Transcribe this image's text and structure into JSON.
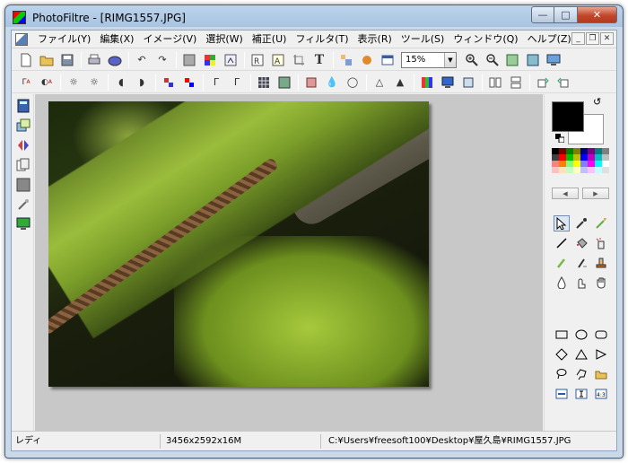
{
  "window": {
    "title": "PhotoFiltre - [RIMG1557.JPG]"
  },
  "menu": {
    "items": [
      "ファイル(Y)",
      "編集(X)",
      "イメージ(V)",
      "選択(W)",
      "補正(U)",
      "フィルタ(T)",
      "表示(R)",
      "ツール(S)",
      "ウィンドウ(Q)",
      "ヘルプ(Z)"
    ]
  },
  "toolbar": {
    "zoom_value": "15%"
  },
  "status": {
    "state": "レディ",
    "dimensions": "3456x2592x16M",
    "path": "C:¥Users¥freesoft100¥Desktop¥屋久島¥RIMG1557.JPG"
  },
  "colors": {
    "foreground": "#000000",
    "background": "#ffffff",
    "accent": "#4a5f7a",
    "palette": [
      "#000000",
      "#7f0000",
      "#007f00",
      "#7f7f00",
      "#00007f",
      "#7f007f",
      "#007f7f",
      "#7f7f7f",
      "#404040",
      "#ff0000",
      "#00c000",
      "#c0c000",
      "#0000ff",
      "#c000c0",
      "#00c0c0",
      "#c0c0c0",
      "#ff8080",
      "#ff8000",
      "#80ff80",
      "#ffff00",
      "#8080ff",
      "#ff00ff",
      "#00ffff",
      "#ffffff",
      "#ffc0c0",
      "#ffe0c0",
      "#c0ffc0",
      "#ffffc0",
      "#c0c0ff",
      "#ffc0ff",
      "#c0ffff",
      "#e0e0e0"
    ]
  }
}
